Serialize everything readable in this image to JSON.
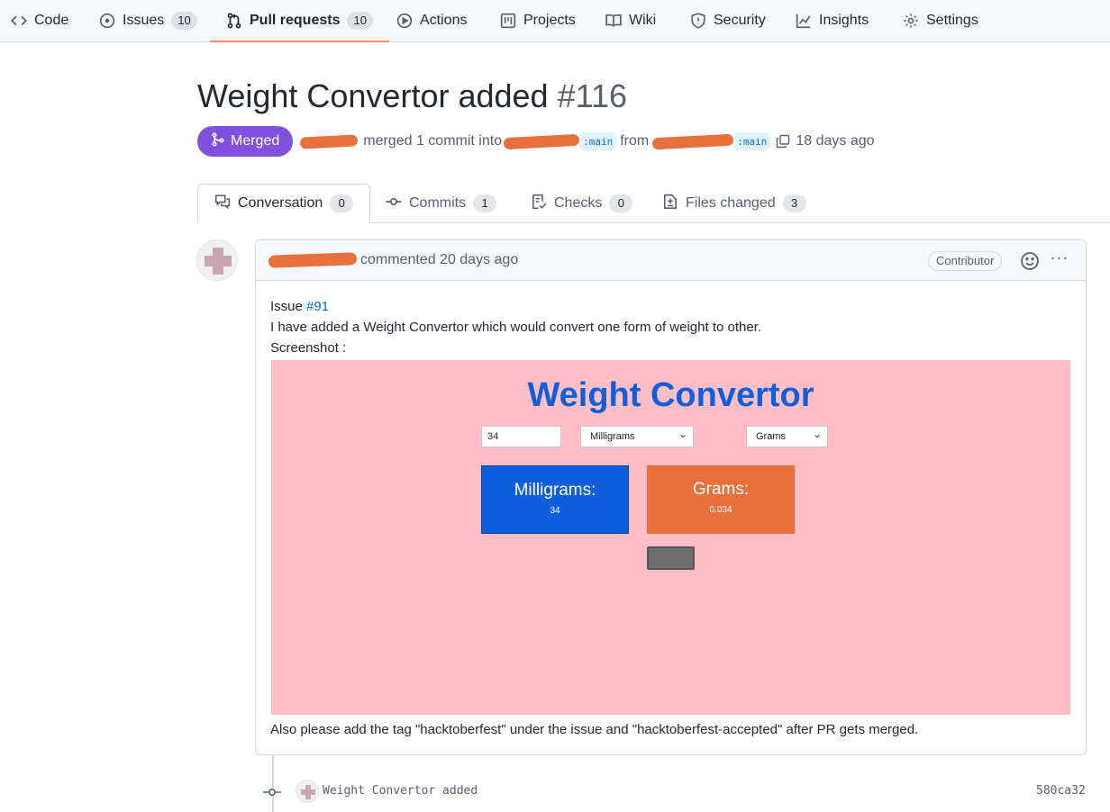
{
  "repo_nav": {
    "items": [
      {
        "label": "Code",
        "icon": "code-icon"
      },
      {
        "label": "Issues",
        "icon": "issue-icon",
        "count": "10"
      },
      {
        "label": "Pull requests",
        "icon": "pull-request-icon",
        "count": "10",
        "active": true
      },
      {
        "label": "Actions",
        "icon": "play-icon"
      },
      {
        "label": "Projects",
        "icon": "project-board-icon"
      },
      {
        "label": "Wiki",
        "icon": "book-icon"
      },
      {
        "label": "Security",
        "icon": "shield-icon"
      },
      {
        "label": "Insights",
        "icon": "graph-icon"
      },
      {
        "label": "Settings",
        "icon": "gear-icon"
      }
    ]
  },
  "pr": {
    "title": "Weight Convertor added",
    "number": "#116",
    "state": "Merged",
    "merged_text": "merged 1 commit into",
    "base_branch": ":main",
    "from_text": "from",
    "head_branch": ":main",
    "time_ago": "18 days ago"
  },
  "tabs": [
    {
      "label": "Conversation",
      "count": "0",
      "icon": "comment-discussion-icon",
      "active": true
    },
    {
      "label": "Commits",
      "count": "1",
      "icon": "commit-icon"
    },
    {
      "label": "Checks",
      "count": "0",
      "icon": "checklist-icon"
    },
    {
      "label": "Files changed",
      "count": "3",
      "icon": "file-diff-icon"
    }
  ],
  "comment": {
    "action": "commented 20 days ago",
    "role": "Contributor",
    "issue_prefix": "Issue",
    "issue_link": "#91",
    "line2": "I have added a Weight Convertor which would convert one form of weight to other.",
    "line3": "Screenshot :",
    "footer": "Also please add the tag \"hacktoberfest\" under the issue and \"hacktoberfest-accepted\" after PR gets merged."
  },
  "embedded_screenshot": {
    "title": "Weight Convertor",
    "input_value": "34",
    "from_unit": "Milligrams",
    "to_unit": "Grams",
    "card_from": {
      "title": "Milligrams:",
      "value": "34"
    },
    "card_to": {
      "title": "Grams:",
      "value": "0.034"
    },
    "colors": {
      "background": "#ffbdc6",
      "title": "#0d5fdc",
      "card_from": "#0d5fdc",
      "card_to": "#e8703c"
    }
  },
  "commit": {
    "message": "Weight Convertor added",
    "sha": "580ca32"
  },
  "colors": {
    "merged_badge": "#8250df",
    "link": "#0969da",
    "redaction": "#e8703c",
    "active_tab_underline": "#fd8c73"
  }
}
